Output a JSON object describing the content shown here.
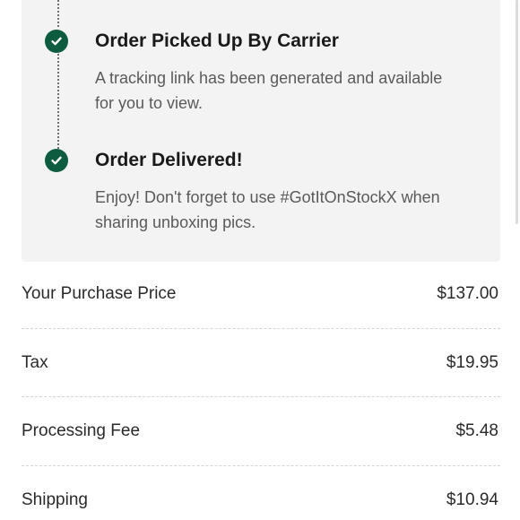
{
  "timeline": {
    "steps": [
      {
        "title": "Order Picked Up By Carrier",
        "description": "A tracking link has been generated and available for you to view.",
        "status_icon": "check-circle-icon"
      },
      {
        "title": "Order Delivered!",
        "description": "Enjoy! Don't forget to use #GotItOnStockX when sharing unboxing pics.",
        "status_icon": "check-circle-icon"
      }
    ],
    "accent_color": "#0d5c3f"
  },
  "price_breakdown": {
    "rows": [
      {
        "label": "Your Purchase Price",
        "value": "$137.00"
      },
      {
        "label": "Tax",
        "value": "$19.95"
      },
      {
        "label": "Processing Fee",
        "value": "$5.48"
      },
      {
        "label": "Shipping",
        "value": "$10.94"
      }
    ]
  }
}
